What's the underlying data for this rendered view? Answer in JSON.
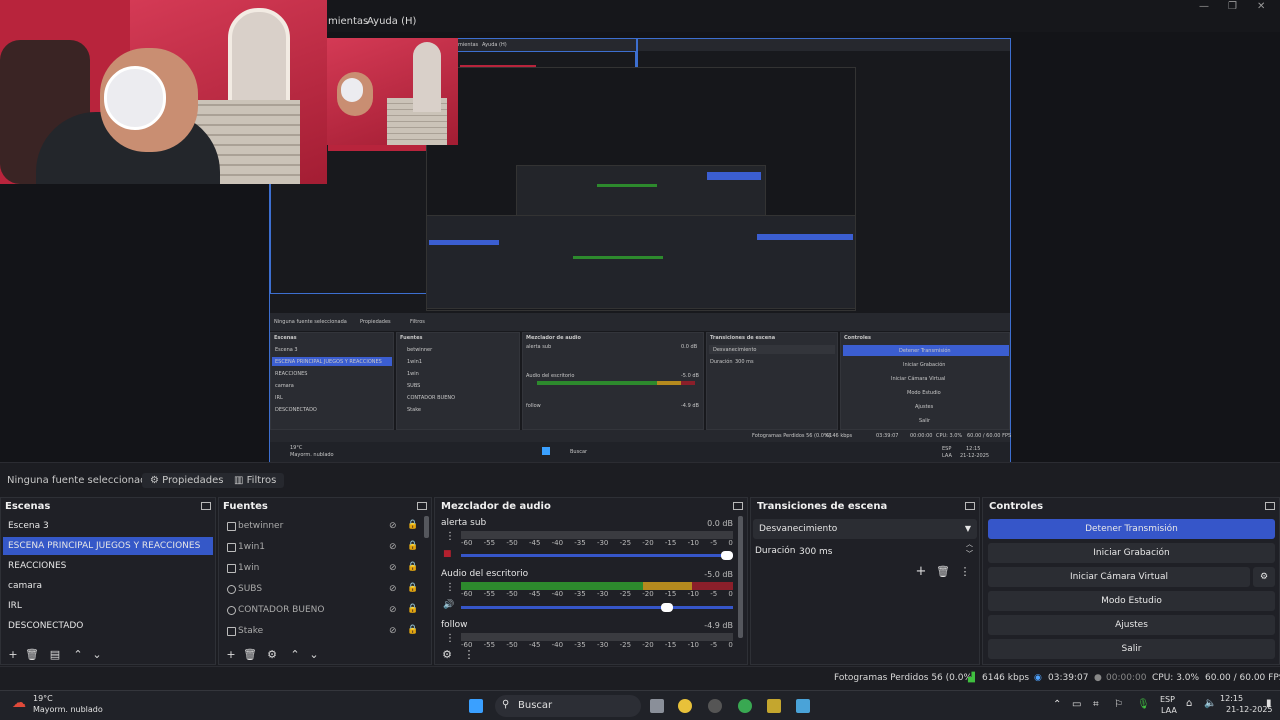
{
  "menu": {
    "items": [
      "mientas",
      "Ayuda (H)"
    ]
  },
  "preview": {
    "nested_menu": [
      "mientas",
      "Ayuda (H)"
    ],
    "nested_below": [
      "Ninguna fuente seleccionada",
      "Propiedades",
      "Filtros"
    ],
    "nested_docks": [
      "Escenas",
      "Fuentes",
      "Mezclador de audio",
      "Transiciones de escena",
      "Controles"
    ],
    "nested_scenes": [
      "Escena 3",
      "ESCENA PRINCIPAL JUEGOS Y REACCIONES",
      "REACCIONES",
      "camara",
      "IRL",
      "DESCONECTADO"
    ],
    "nested_sources": [
      "betwinner",
      "1win1",
      "1win",
      "SUBS",
      "CONTADOR BUENO",
      "Stake"
    ],
    "nested_meters": [
      "alerta sub",
      "Audio del escritorio",
      "follow"
    ],
    "nested_meter_db": [
      "0.0 dB",
      "-5.0 dB",
      "-4.9 dB"
    ],
    "nested_transition": "Desvanecimiento",
    "nested_duration_label": "Duración",
    "nested_duration": "300 ms",
    "nested_controls": [
      "Detener Transmisión",
      "Iniciar Grabación",
      "Iniciar Cámara Virtual",
      "Modo Estudio",
      "Ajustes",
      "Salir"
    ],
    "nested_status": [
      "Fotogramas Perdidos 56 (0.0%)",
      "6146 kbps",
      "03:39:07",
      "00:00:00",
      "CPU: 3.0%",
      "60.00 / 60.00 FPS"
    ],
    "nested_weather": [
      "19°C",
      "Mayorm. nublado"
    ],
    "nested_search": "Buscar",
    "nested_clock": [
      "12:15",
      "21-12-2025"
    ],
    "nested_lang": [
      "ESP",
      "LAA"
    ]
  },
  "below_preview": {
    "no_source": "Ninguna fuente seleccionada",
    "properties": "Propiedades",
    "filters": "Filtros"
  },
  "scenes": {
    "title": "Escenas",
    "items": [
      "Escena 3",
      "ESCENA PRINCIPAL JUEGOS Y REACCIONES",
      "REACCIONES",
      "camara",
      "IRL",
      "DESCONECTADO"
    ],
    "selected": 1
  },
  "sources": {
    "title": "Fuentes",
    "items": [
      "betwinner",
      "1win1",
      "1win",
      "SUBS",
      "CONTADOR BUENO",
      "Stake"
    ]
  },
  "mixer": {
    "title": "Mezclador de audio",
    "ticks": [
      "-60",
      "-55",
      "-50",
      "-45",
      "-40",
      "-35",
      "-30",
      "-25",
      "-20",
      "-15",
      "-10",
      "-5",
      "0"
    ],
    "channels": [
      {
        "name": "alerta sub",
        "db": "0.0 dB",
        "level": 0,
        "volume": 1.0
      },
      {
        "name": "Audio del escritorio",
        "db": "-5.0 dB",
        "level": 1.0,
        "volume": 0.78
      },
      {
        "name": "follow",
        "db": "-4.9 dB",
        "level": 0,
        "volume": 0.8
      }
    ]
  },
  "transitions": {
    "title": "Transiciones de escena",
    "selected": "Desvanecimiento",
    "duration_label": "Duración",
    "duration": "300 ms"
  },
  "controls": {
    "title": "Controles",
    "buttons": [
      "Detener Transmisión",
      "Iniciar Grabación",
      "Iniciar Cámara Virtual",
      "Modo Estudio",
      "Ajustes",
      "Salir"
    ]
  },
  "status": {
    "dropped": "Fotogramas Perdidos 56 (0.0%)",
    "bitrate": "6146 kbps",
    "live_time": "03:39:07",
    "rec_time": "00:00:00",
    "cpu": "CPU: 3.0%",
    "fps": "60.00 / 60.00 FPS"
  },
  "taskbar": {
    "weather_temp": "19°C",
    "weather_desc": "Mayorm. nublado",
    "search": "Buscar",
    "lang1": "ESP",
    "lang2": "LAA",
    "time": "12:15",
    "date": "21-12-2025"
  },
  "colors": {
    "accent": "#3656c9",
    "meter_green": "#2d8a2d",
    "meter_yellow": "#b58a1e",
    "meter_red": "#8a1f2a"
  }
}
